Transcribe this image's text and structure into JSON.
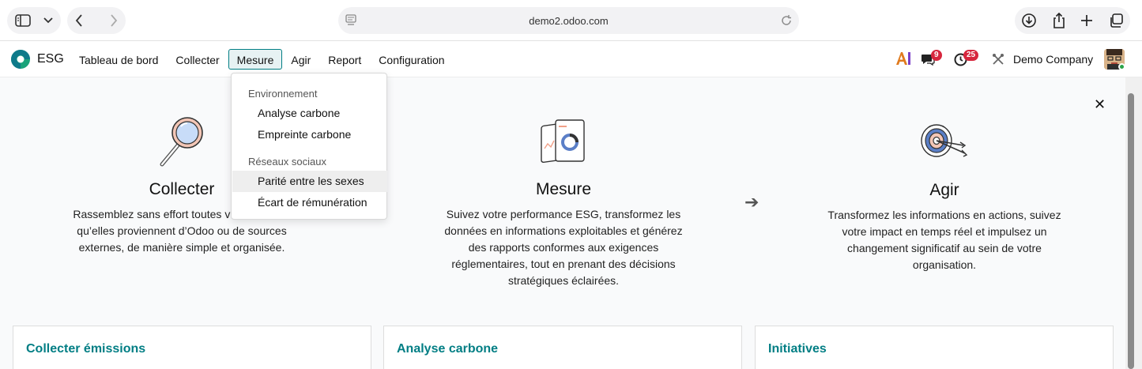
{
  "browser": {
    "url": "demo2.odoo.com",
    "icons": [
      "sidebar-icon",
      "chevron-down-icon",
      "back-icon",
      "forward-icon",
      "page-icon",
      "reload-icon",
      "download-icon",
      "share-icon",
      "plus-icon",
      "tabs-icon"
    ]
  },
  "navbar": {
    "app_name": "ESG",
    "menu": [
      "Tableau de bord",
      "Collecter",
      "Mesure",
      "Agir",
      "Report",
      "Configuration"
    ],
    "active_menu": "Mesure",
    "chat_count": "9",
    "activity_count": "25",
    "company": "Demo Company",
    "colors": {
      "accent": "#017e84",
      "badge": "#d7263d",
      "ai": "#e07b1f"
    }
  },
  "dropdown": {
    "sections": [
      {
        "header": "Environnement",
        "items": [
          "Analyse carbone",
          "Empreinte carbone"
        ]
      },
      {
        "header": "Réseaux sociaux",
        "items": [
          "Parité entre les sexes",
          "Écart de rémunération"
        ]
      }
    ],
    "hovered_item": "Parité entre les sexes"
  },
  "steps": {
    "collect": {
      "title": "Collecter",
      "lines": [
        "Rassemblez sans effort toutes vos données,",
        "qu’elles proviennent d’Odoo ou de sources",
        "externes, de manière simple et organisée."
      ]
    },
    "measure": {
      "title": "Mesure",
      "lines": [
        "Suivez votre performance ESG, transformez les",
        "données en informations exploitables et générez",
        "des rapports conformes aux exigences",
        "réglementaires, tout en prenant des décisions",
        "stratégiques éclairées."
      ]
    },
    "act": {
      "title": "Agir",
      "lines": [
        "Transformez les informations en actions, suivez",
        "votre impact en temps réel et impulsez un",
        "changement significatif au sein de votre",
        "organisation."
      ]
    },
    "arrow": "➔",
    "close": "✕"
  },
  "cards": [
    "Collecter émissions",
    "Analyse carbone",
    "Initiatives"
  ]
}
